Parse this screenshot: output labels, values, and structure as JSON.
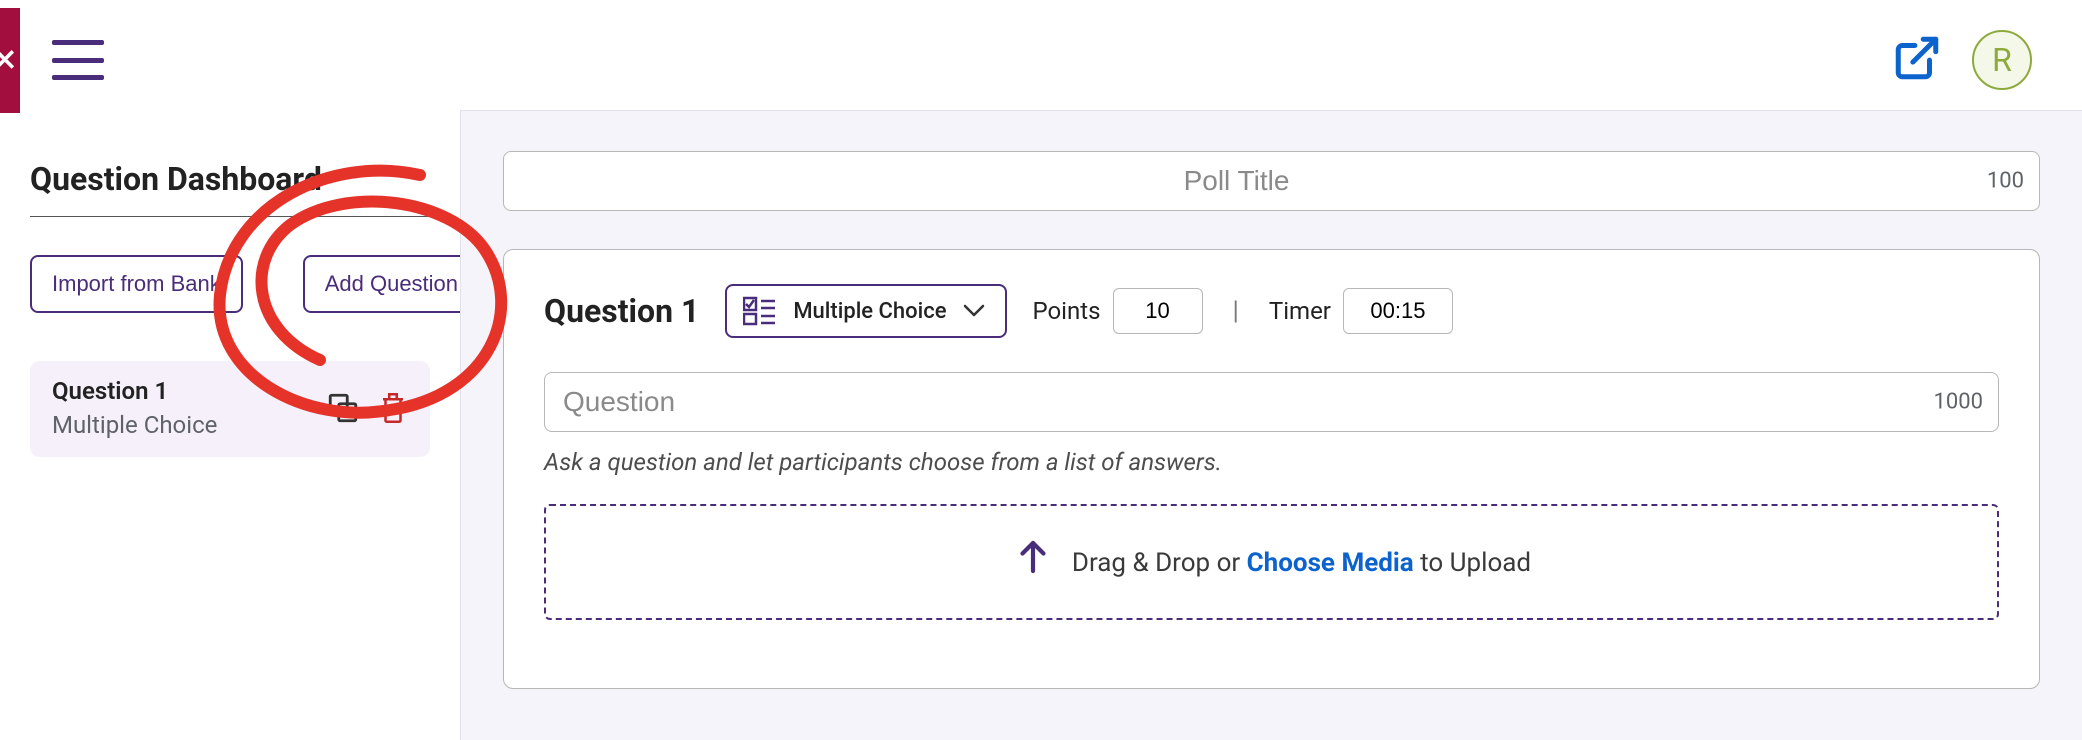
{
  "topbar": {
    "avatar_letter": "R"
  },
  "sidebar": {
    "title": "Question Dashboard",
    "import_btn": "Import from Bank",
    "add_btn": "Add Question",
    "question_card": {
      "title": "Question 1",
      "type": "Multiple Choice"
    }
  },
  "main": {
    "poll_title_placeholder": "Poll Title",
    "poll_title_chars": "100",
    "question_panel": {
      "title": "Question 1",
      "type_label": "Multiple Choice",
      "points_label": "Points",
      "points_value": "10",
      "timer_label": "Timer",
      "timer_value": "00:15",
      "divider": "|",
      "question_placeholder": "Question",
      "question_chars": "1000",
      "helper": "Ask a question and let participants choose from a list of answers.",
      "upload_prefix": "Drag & Drop or ",
      "upload_choose": "Choose Media",
      "upload_suffix": " to Upload"
    }
  }
}
